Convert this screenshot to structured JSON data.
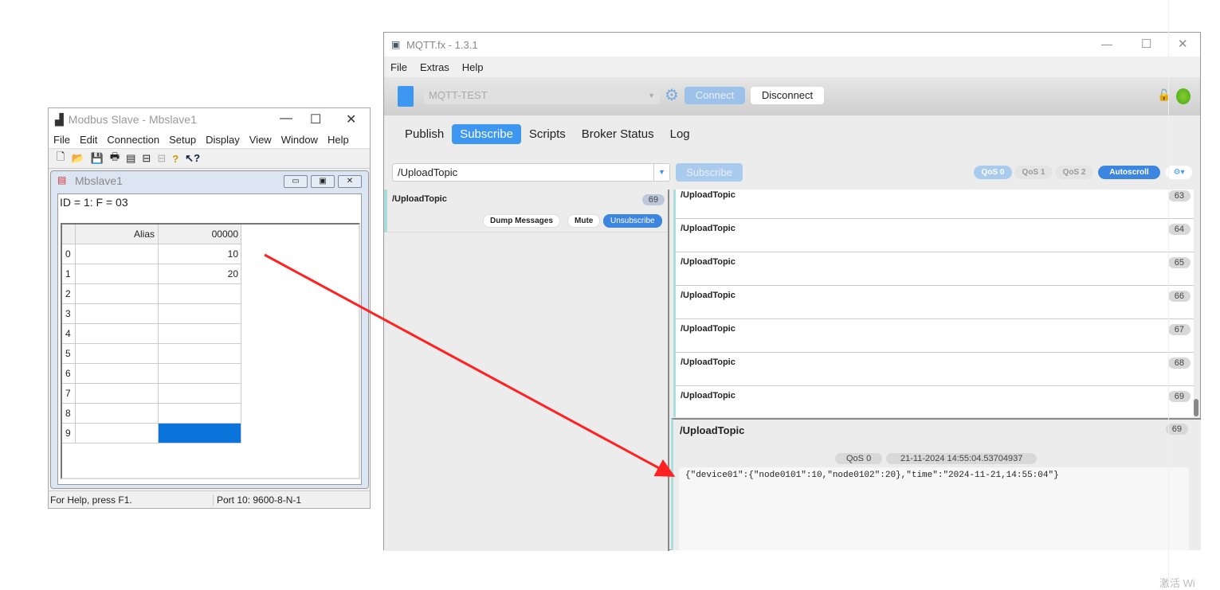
{
  "modbus": {
    "title": "Modbus Slave - Mbslave1",
    "menu": [
      "File",
      "Edit",
      "Connection",
      "Setup",
      "Display",
      "View",
      "Window",
      "Help"
    ],
    "child_title": "Mbslave1",
    "id_line": "ID = 1: F = 03",
    "headers": {
      "alias": "Alias",
      "address": "00000"
    },
    "rows": [
      {
        "n": "0",
        "v": "10"
      },
      {
        "n": "1",
        "v": "20"
      },
      {
        "n": "2",
        "v": ""
      },
      {
        "n": "3",
        "v": ""
      },
      {
        "n": "4",
        "v": ""
      },
      {
        "n": "5",
        "v": ""
      },
      {
        "n": "6",
        "v": ""
      },
      {
        "n": "7",
        "v": ""
      },
      {
        "n": "8",
        "v": ""
      },
      {
        "n": "9",
        "v": ""
      }
    ],
    "status_help": "For Help, press F1.",
    "status_port": "Port 10: 9600-8-N-1"
  },
  "mqtt": {
    "title": "MQTT.fx - 1.3.1",
    "menu": [
      "File",
      "Extras",
      "Help"
    ],
    "profile": "MQTT-TEST",
    "connect": "Connect",
    "disconnect": "Disconnect",
    "tabs": [
      "Publish",
      "Subscribe",
      "Scripts",
      "Broker Status",
      "Log"
    ],
    "active_tab": "Subscribe",
    "topic_input": "/UploadTopic",
    "subscribe_btn": "Subscribe",
    "qos": [
      "QoS 0",
      "QoS 1",
      "QoS 2"
    ],
    "autoscroll": "Autoscroll",
    "subscription": {
      "topic": "/UploadTopic",
      "count": "69",
      "dump": "Dump Messages",
      "mute": "Mute",
      "unsubscribe": "Unsubscribe"
    },
    "messages": [
      {
        "topic": "/UploadTopic",
        "n": "63"
      },
      {
        "topic": "/UploadTopic",
        "n": "64"
      },
      {
        "topic": "/UploadTopic",
        "n": "65"
      },
      {
        "topic": "/UploadTopic",
        "n": "66"
      },
      {
        "topic": "/UploadTopic",
        "n": "67"
      },
      {
        "topic": "/UploadTopic",
        "n": "68"
      },
      {
        "topic": "/UploadTopic",
        "n": "69"
      }
    ],
    "detail": {
      "topic": "/UploadTopic",
      "n": "69",
      "qos": "QoS 0",
      "timestamp": "21-11-2024  14:55:04.53704937",
      "payload": "{\"device01\":{\"node0101\":10,\"node0102\":20},\"time\":\"2024-11-21,14:55:04\"}"
    },
    "accent": "#3d96f0"
  },
  "watermark": "激活 Wi"
}
